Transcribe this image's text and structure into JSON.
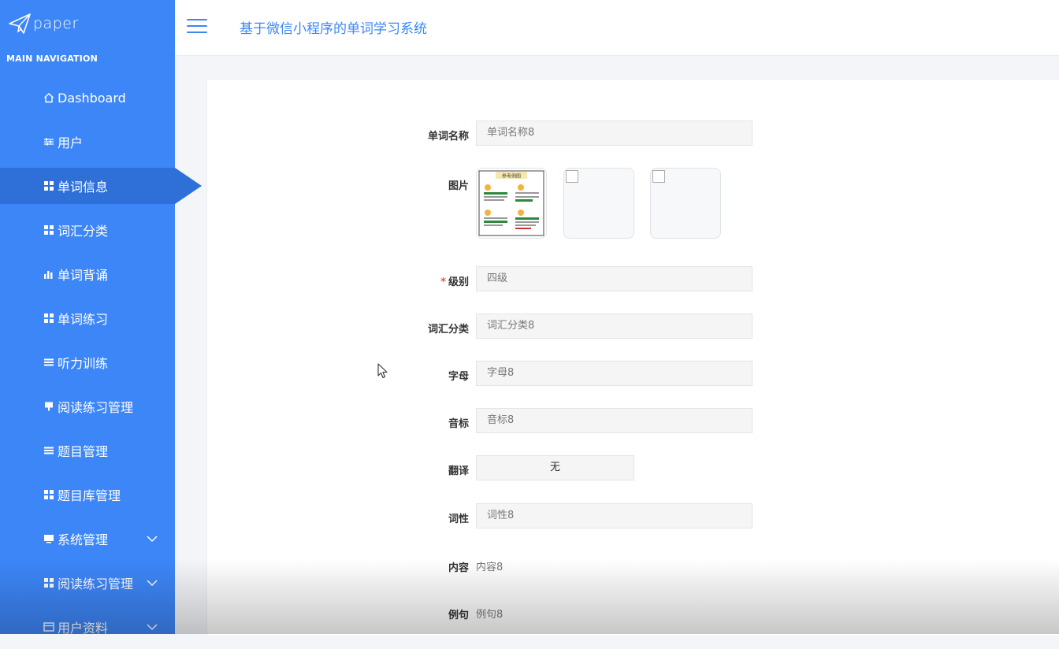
{
  "app": {
    "logo_text": "paper",
    "title": "基于微信小程序的单词学习系统"
  },
  "sidebar": {
    "header": "MAIN NAVIGATION",
    "items": [
      {
        "label": "Dashboard",
        "icon": "home-icon"
      },
      {
        "label": "用户",
        "icon": "sliders-icon"
      },
      {
        "label": "单词信息",
        "icon": "grid-icon",
        "active": true
      },
      {
        "label": "词汇分类",
        "icon": "grid-icon"
      },
      {
        "label": "单词背诵",
        "icon": "bar-chart-icon"
      },
      {
        "label": "单词练习",
        "icon": "grid-icon"
      },
      {
        "label": "听力训练",
        "icon": "list-icon"
      },
      {
        "label": "阅读练习管理",
        "icon": "pin-icon"
      },
      {
        "label": "题目管理",
        "icon": "list-icon"
      },
      {
        "label": "题目库管理",
        "icon": "grid-icon"
      },
      {
        "label": "系统管理",
        "icon": "monitor-icon",
        "expandable": true
      },
      {
        "label": "阅读练习管理",
        "icon": "grid-icon",
        "expandable": true
      },
      {
        "label": "用户资料",
        "icon": "card-icon",
        "expandable": true
      }
    ]
  },
  "form": {
    "word_name": {
      "label": "单词名称",
      "value": "单词名称8"
    },
    "image": {
      "label": "图片",
      "thumb_title": "参考例图"
    },
    "level": {
      "label": "级别",
      "required_mark": "*",
      "value": "四级"
    },
    "category": {
      "label": "词汇分类",
      "value": "词汇分类8"
    },
    "letter": {
      "label": "字母",
      "value": "字母8"
    },
    "phonetic": {
      "label": "音标",
      "value": "音标8"
    },
    "translation": {
      "label": "翻译",
      "value": "无"
    },
    "pos": {
      "label": "词性",
      "value": "词性8"
    },
    "content": {
      "label": "内容",
      "value": "内容8"
    },
    "example": {
      "label": "例句",
      "value": "例句8"
    }
  },
  "colors": {
    "sidebar": "#3d86f8",
    "sidebar_active": "#2f6fd8",
    "accent": "#3d86f8",
    "required": "#e5554d"
  }
}
